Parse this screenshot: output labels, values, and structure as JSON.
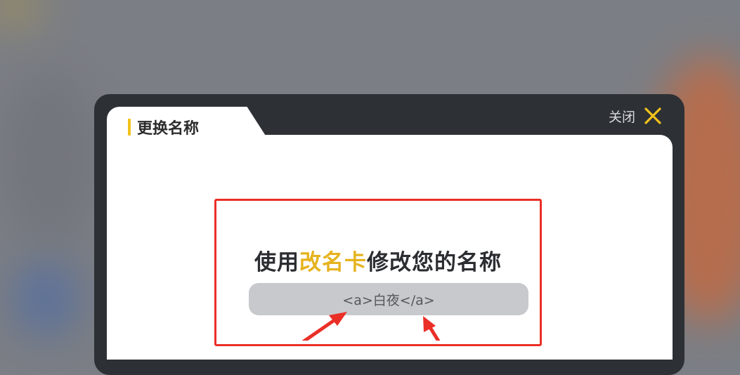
{
  "dialog": {
    "tab_title": "更换名称",
    "close_label": "关闭",
    "prompt_before": "使用",
    "prompt_highlight": "改名卡",
    "prompt_after": "修改您的名称",
    "name_value": "<a>白夜</a>"
  },
  "colors": {
    "accent": "#e6b21f",
    "tab_bar": "#f3c21b",
    "annotation_red": "#ea2f27",
    "dialog_frame": "#2d3136",
    "input_bg": "#c8c9cc"
  },
  "icons": {
    "close": "close-x-icon",
    "annotation": "red-arrow-icon"
  }
}
